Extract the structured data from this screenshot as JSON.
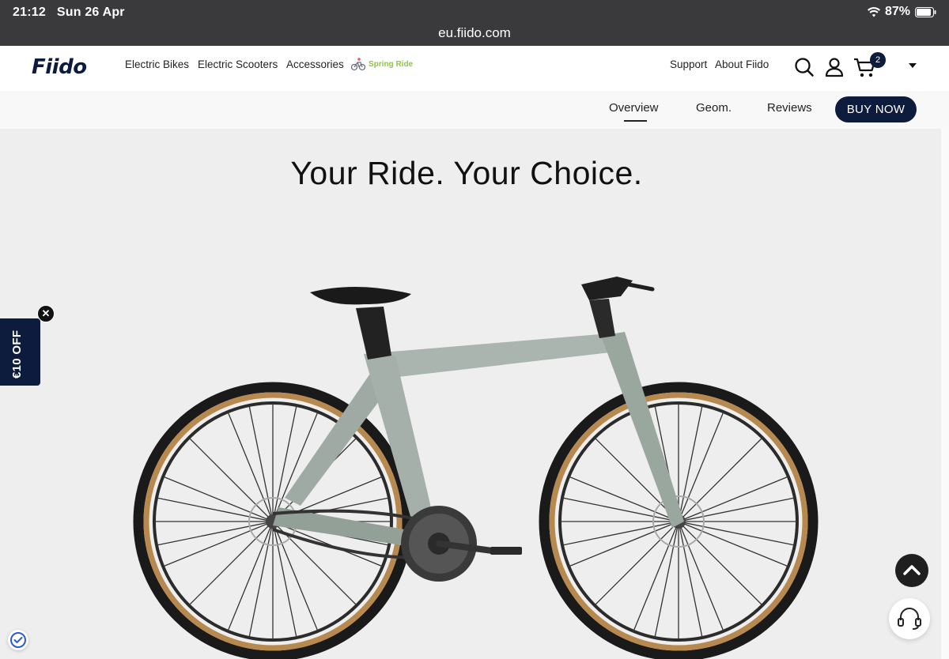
{
  "status": {
    "time": "21:12",
    "date": "Sun 26 Apr",
    "battery": "87%"
  },
  "browser": {
    "url": "eu.fiido.com"
  },
  "nav": {
    "logo": "Fiido",
    "links": [
      "Electric Bikes",
      "Electric Scooters",
      "Accessories"
    ],
    "promo": "Spring Ride",
    "support": "Support",
    "about": "About Fiido",
    "cart_count": "2"
  },
  "subnav": {
    "overview": "Overview",
    "geom": "Geom.",
    "reviews": "Reviews",
    "buy": "BUY NOW"
  },
  "hero": {
    "headline": "Your Ride. Your Choice."
  },
  "promo_tab": {
    "label": "€10 OFF",
    "close": "✕"
  },
  "icons": [
    "wifi-icon",
    "battery-icon",
    "search-icon",
    "account-icon",
    "cart-icon",
    "chevron-down-icon",
    "close-icon",
    "chevron-up-icon",
    "headset-icon",
    "shield-check-icon"
  ],
  "colors": {
    "brand_navy": "#0d1b3d",
    "promo_green": "#8dc63f",
    "status_bar": "#3a3a3c"
  }
}
